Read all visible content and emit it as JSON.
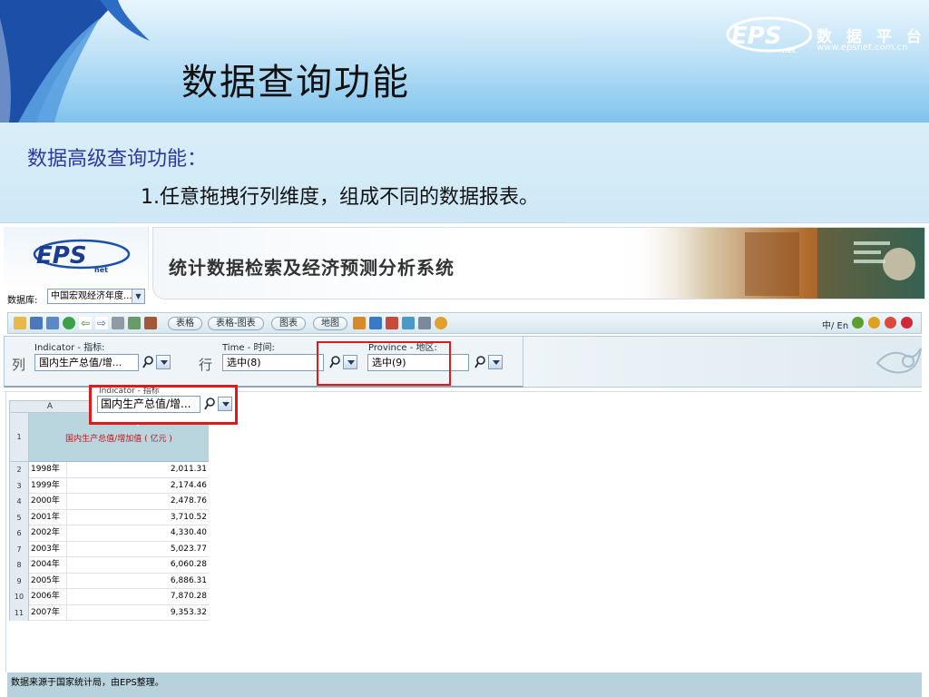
{
  "slide": {
    "title": "数据查询功能",
    "subtitle_heading": "数据高级查询功能：",
    "subtitle_point": "1.任意拖拽行列维度，组成不同的数据报表。",
    "logo": {
      "cn_text": "数 据 平 台",
      "url_text": "www.epsnet.com.cn",
      "mark_text": "EPS",
      "mark_sub": "net"
    }
  },
  "app": {
    "logo_text": "EPS",
    "logo_sub": "net",
    "system_title": "统计数据检索及经济预测分析系统",
    "database_label": "数据库:",
    "database_value": "中国宏观经济年度...",
    "toolbar": {
      "buttons": [
        "表格",
        "表格-图表",
        "图表",
        "地图"
      ],
      "lang_switch": "中/ En"
    },
    "dimensions": {
      "col_label": "列",
      "row_label": "行",
      "indicator": {
        "caption": "Indicator - 指标:",
        "value": "国内生产总值/增..."
      },
      "time": {
        "caption": "Time - 时间:",
        "value": "选中(8)"
      },
      "province": {
        "caption": "Province - 地区:",
        "value": "选中(9)"
      }
    },
    "drag_ghost": {
      "caption": "Indicator - 指标",
      "value": "国内生产总值/增..."
    },
    "grid": {
      "column_label": "A",
      "header_rownum": "1",
      "header_indicator": "国内生产总值/增加值 ( 亿元 )",
      "rows": [
        {
          "num": "2",
          "year": "1998年",
          "value": "2,011.31"
        },
        {
          "num": "3",
          "year": "1999年",
          "value": "2,174.46"
        },
        {
          "num": "4",
          "year": "2000年",
          "value": "2,478.76"
        },
        {
          "num": "5",
          "year": "2001年",
          "value": "3,710.52"
        },
        {
          "num": "6",
          "year": "2002年",
          "value": "4,330.40"
        },
        {
          "num": "7",
          "year": "2003年",
          "value": "5,023.77"
        },
        {
          "num": "8",
          "year": "2004年",
          "value": "6,060.28"
        },
        {
          "num": "9",
          "year": "2005年",
          "value": "6,886.31"
        },
        {
          "num": "10",
          "year": "2006年",
          "value": "7,870.28"
        },
        {
          "num": "11",
          "year": "2007年",
          "value": "9,353.32"
        }
      ]
    },
    "source_note": "数据来源于国家统计局，由EPS整理。"
  },
  "colors": {
    "title_blue": "#2b3aa0",
    "highlight_red": "#e01a1a",
    "header_cell": "#b9d5dd",
    "indicator_red": "#c0151b",
    "source_bar": "#b7d2dc"
  }
}
